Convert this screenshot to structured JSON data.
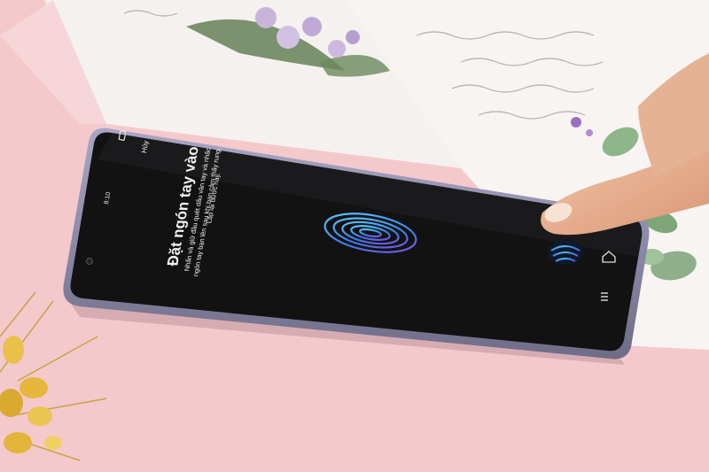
{
  "phone": {
    "status_time": "8:10",
    "cancel_label": "Hủy",
    "title": "Đặt ngón tay vào",
    "instruction_lines": [
      "Nhấn và giữ đầu quét dấu vân tay và nhấc",
      "ngón tay bạn lên sau khi bạn cảm thấy rung.",
      "Lặp lại bước này."
    ]
  },
  "colors": {
    "background": "#f3c9cc",
    "screen": "#121213",
    "fingerprint_accent": "#4aa8f0"
  },
  "icons": [
    "battery-icon",
    "camera-icon",
    "fingerprint-icon",
    "home-icon",
    "menu-icon"
  ]
}
